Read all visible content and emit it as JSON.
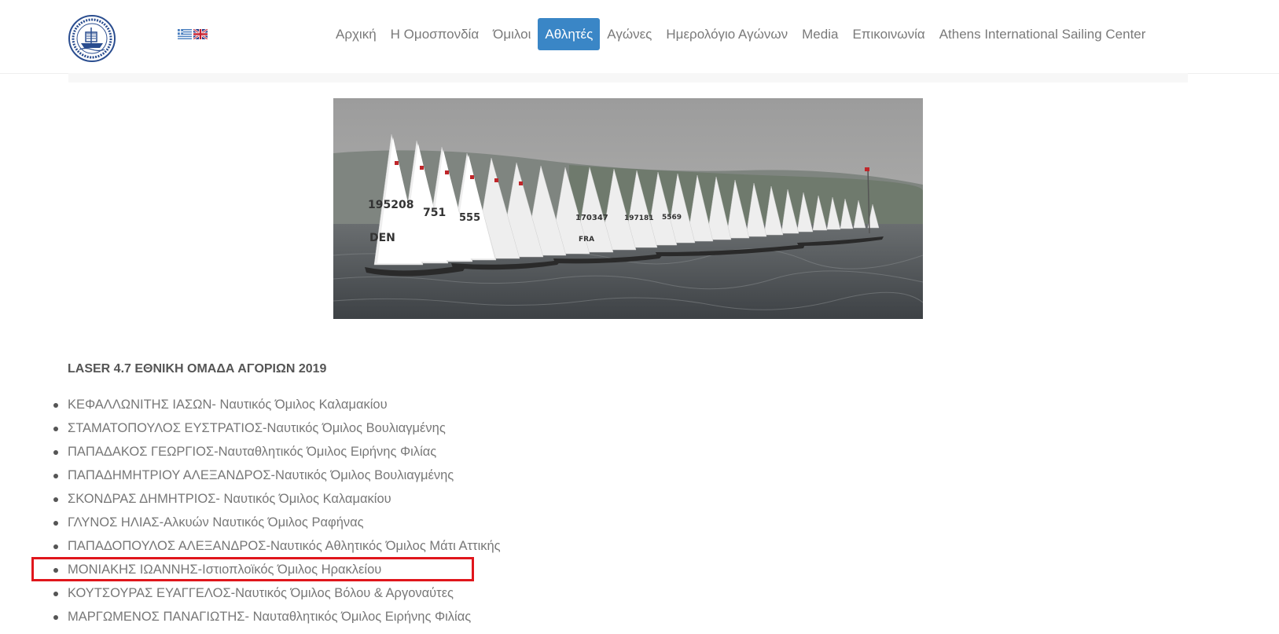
{
  "header": {
    "nav": [
      {
        "label": "Αρχική",
        "active": false
      },
      {
        "label": "Η Ομοσπονδία",
        "active": false
      },
      {
        "label": "Όμιλοι",
        "active": false
      },
      {
        "label": "Αθλητές",
        "active": true
      },
      {
        "label": "Αγώνες",
        "active": false
      },
      {
        "label": "Ημερολόγιο Αγώνων",
        "active": false
      },
      {
        "label": "Media",
        "active": false
      },
      {
        "label": "Επικοινωνία",
        "active": false
      },
      {
        "label": "Athens International Sailing Center",
        "active": false
      }
    ],
    "flags": [
      "greek-flag-icon",
      "uk-flag-icon"
    ],
    "accent_color": "#3a86c6"
  },
  "hero": {
    "sail_numbers": [
      "195208",
      "751",
      "555",
      "170347",
      "197181",
      "5569"
    ],
    "country_code": "DEN",
    "country_code_2": "FRA"
  },
  "main": {
    "section_title": "LASER 4.7 ΕΘΝΙΚΗ ΟΜΑΔΑ ΑΓΟΡΙΩΝ 2019",
    "athletes": [
      "ΚΕΦΑΛΛΩΝΙΤΗΣ ΙΑΣΩΝ- Ναυτικός Όμιλος Καλαμακίου",
      "ΣΤΑΜΑΤΟΠΟΥΛΟΣ ΕΥΣΤΡΑΤΙΟΣ-Ναυτικός Όμιλος Βουλιαγμένης",
      "ΠΑΠΑΔΑΚΟΣ ΓΕΩΡΓΙΟΣ-Ναυταθλητικός Όμιλος Ειρήνης Φιλίας",
      "ΠΑΠΑΔΗΜΗΤΡΙΟΥ ΑΛΕΞΑΝΔΡΟΣ-Ναυτικός Όμιλος Βουλιαγμένης",
      "ΣΚΟΝΔΡΑΣ ΔΗΜΗΤΡΙΟΣ- Ναυτικός Όμιλος Καλαμακίου",
      "ΓΛΥΝΟΣ ΗΛΙΑΣ-Αλκυών Ναυτικός Όμιλος Ραφήνας",
      "ΠΑΠΑΔΟΠΟΥΛΟΣ ΑΛΕΞΑΝΔΡΟΣ-Ναυτικός Αθλητικός Όμιλος Μάτι Αττικής",
      "ΜΟΝΙΑΚΗΣ ΙΩΑΝΝΗΣ-Ιστιοπλοϊκός Όμιλος Ηρακλείου",
      "ΚΟΥΤΣΟΥΡΑΣ ΕΥΑΓΓΕΛΟΣ-Ναυτικός Όμιλος Βόλου & Αργοναύτες",
      "ΜΑΡΓΩΜΕΝΟΣ ΠΑΝΑΓΙΩΤΗΣ- Ναυταθλητικός Όμιλος Ειρήνης Φιλίας"
    ],
    "highlight_color": "#e0161c"
  }
}
